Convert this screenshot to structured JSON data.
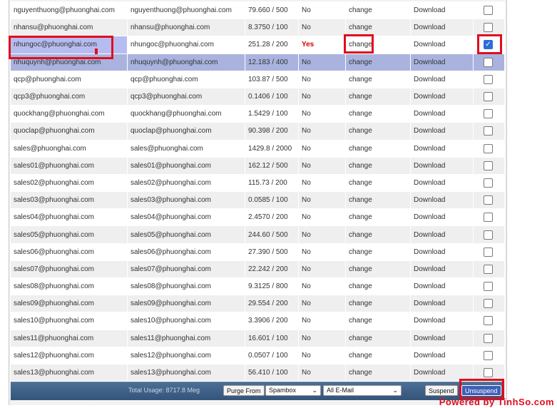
{
  "accounts": [
    {
      "email": "nguyenthuong@phuonghai.com",
      "login": "nguyenthuong@phuonghai.com",
      "usage": "79.660 / 500",
      "suspended": "No",
      "change": "change",
      "download": "Download",
      "checked": false
    },
    {
      "email": "nhansu@phuonghai.com",
      "login": "nhansu@phuonghai.com",
      "usage": "8.3750 / 100",
      "suspended": "No",
      "change": "change",
      "download": "Download",
      "checked": false
    },
    {
      "email": "nhungoc@phuonghai.com",
      "login": "nhungoc@phuonghai.com",
      "usage": "251.28 / 200",
      "suspended": "Yes",
      "change": "change",
      "download": "Download",
      "checked": true
    },
    {
      "email": "nhuquynh@phuonghai.com",
      "login": "nhuquynh@phuonghai.com",
      "usage": "12.183 / 400",
      "suspended": "No",
      "change": "change",
      "download": "Download",
      "checked": false
    },
    {
      "email": "qcp@phuonghai.com",
      "login": "qcp@phuonghai.com",
      "usage": "103.87 / 500",
      "suspended": "No",
      "change": "change",
      "download": "Download",
      "checked": false
    },
    {
      "email": "qcp3@phuonghai.com",
      "login": "qcp3@phuonghai.com",
      "usage": "0.1406 / 100",
      "suspended": "No",
      "change": "change",
      "download": "Download",
      "checked": false
    },
    {
      "email": "quockhang@phuonghai.com",
      "login": "quockhang@phuonghai.com",
      "usage": "1.5429 / 100",
      "suspended": "No",
      "change": "change",
      "download": "Download",
      "checked": false
    },
    {
      "email": "quoclap@phuonghai.com",
      "login": "quoclap@phuonghai.com",
      "usage": "90.398 / 200",
      "suspended": "No",
      "change": "change",
      "download": "Download",
      "checked": false
    },
    {
      "email": "sales@phuonghai.com",
      "login": "sales@phuonghai.com",
      "usage": "1429.8 / 2000",
      "suspended": "No",
      "change": "change",
      "download": "Download",
      "checked": false
    },
    {
      "email": "sales01@phuonghai.com",
      "login": "sales01@phuonghai.com",
      "usage": "162.12 / 500",
      "suspended": "No",
      "change": "change",
      "download": "Download",
      "checked": false
    },
    {
      "email": "sales02@phuonghai.com",
      "login": "sales02@phuonghai.com",
      "usage": "115.73 / 200",
      "suspended": "No",
      "change": "change",
      "download": "Download",
      "checked": false
    },
    {
      "email": "sales03@phuonghai.com",
      "login": "sales03@phuonghai.com",
      "usage": "0.0585 / 100",
      "suspended": "No",
      "change": "change",
      "download": "Download",
      "checked": false
    },
    {
      "email": "sales04@phuonghai.com",
      "login": "sales04@phuonghai.com",
      "usage": "2.4570 / 200",
      "suspended": "No",
      "change": "change",
      "download": "Download",
      "checked": false
    },
    {
      "email": "sales05@phuonghai.com",
      "login": "sales05@phuonghai.com",
      "usage": "244.60 / 500",
      "suspended": "No",
      "change": "change",
      "download": "Download",
      "checked": false
    },
    {
      "email": "sales06@phuonghai.com",
      "login": "sales06@phuonghai.com",
      "usage": "27.390 / 500",
      "suspended": "No",
      "change": "change",
      "download": "Download",
      "checked": false
    },
    {
      "email": "sales07@phuonghai.com",
      "login": "sales07@phuonghai.com",
      "usage": "22.242 / 200",
      "suspended": "No",
      "change": "change",
      "download": "Download",
      "checked": false
    },
    {
      "email": "sales08@phuonghai.com",
      "login": "sales08@phuonghai.com",
      "usage": "9.3125 / 800",
      "suspended": "No",
      "change": "change",
      "download": "Download",
      "checked": false
    },
    {
      "email": "sales09@phuonghai.com",
      "login": "sales09@phuonghai.com",
      "usage": "29.554 / 200",
      "suspended": "No",
      "change": "change",
      "download": "Download",
      "checked": false
    },
    {
      "email": "sales10@phuonghai.com",
      "login": "sales10@phuonghai.com",
      "usage": "3.3906 / 200",
      "suspended": "No",
      "change": "change",
      "download": "Download",
      "checked": false
    },
    {
      "email": "sales11@phuonghai.com",
      "login": "sales11@phuonghai.com",
      "usage": "16.601 / 100",
      "suspended": "No",
      "change": "change",
      "download": "Download",
      "checked": false
    },
    {
      "email": "sales12@phuonghai.com",
      "login": "sales12@phuonghai.com",
      "usage": "0.0507 / 100",
      "suspended": "No",
      "change": "change",
      "download": "Download",
      "checked": false
    },
    {
      "email": "sales13@phuonghai.com",
      "login": "sales13@phuonghai.com",
      "usage": "56.410 / 100",
      "suspended": "No",
      "change": "change",
      "download": "Download",
      "checked": false
    }
  ],
  "footer": {
    "total_usage": "Total Usage: 8717.8 Meg",
    "purge_label": "Purge From",
    "folder_select": "Spambox",
    "scope_select": "All E-Mail",
    "suspend_label": "Suspend",
    "unsuspend_label": "Unsuspend"
  },
  "watermark": "Powered by TinhSo.com",
  "colors": {
    "highlight_row": "#a9b3de",
    "annotation_red": "#e00d1e",
    "footer_bg": "#3f6288",
    "yes_red": "#d40000"
  }
}
